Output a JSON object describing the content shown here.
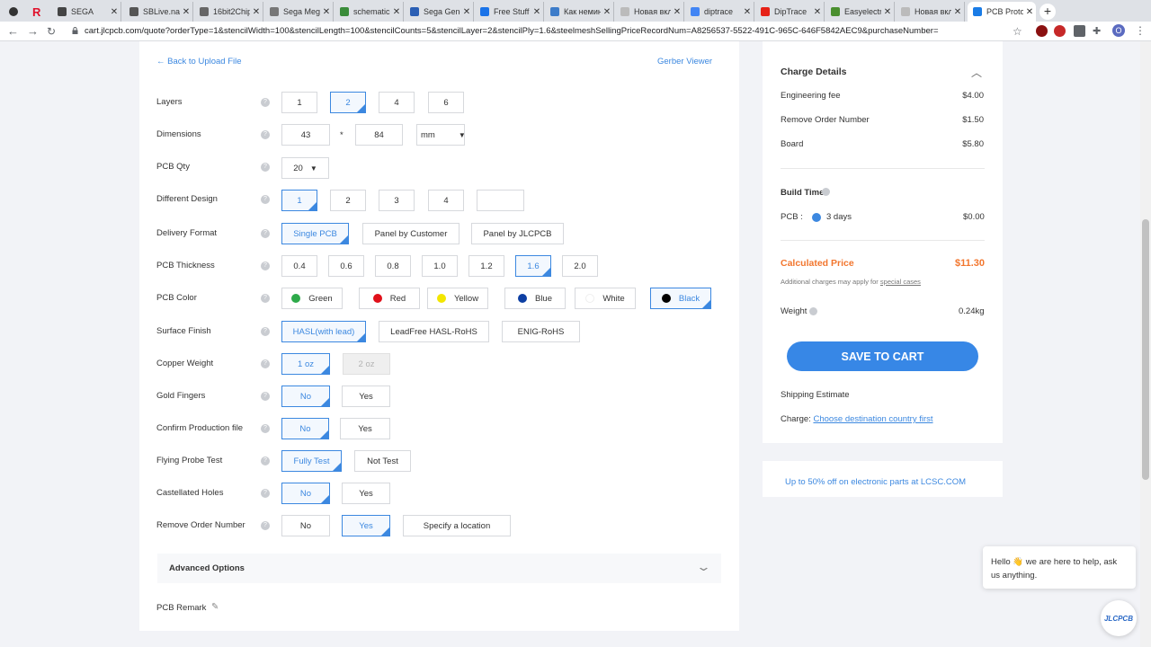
{
  "browser": {
    "tabs": [
      {
        "title": "SEGA",
        "favicon_color": "#444"
      },
      {
        "title": "SBLive.narod.ru",
        "favicon_color": "#555"
      },
      {
        "title": "16bit2Chip",
        "favicon_color": "#666"
      },
      {
        "title": "Sega Mega Drive",
        "favicon_color": "#777"
      },
      {
        "title": "schematic",
        "favicon_color": "#3a8c3a"
      },
      {
        "title": "Sega Genesis",
        "favicon_color": "#2b5fb4"
      },
      {
        "title": "Free Stuff",
        "favicon_color": "#1a73e8"
      },
      {
        "title": "Как неминуемо",
        "favicon_color": "#3d7cc9"
      },
      {
        "title": "Новая вкладка",
        "favicon_color": "#bbb"
      },
      {
        "title": "diptrace",
        "favicon_color": "#4285f4"
      },
      {
        "title": "DipTrace",
        "favicon_color": "#e62117"
      },
      {
        "title": "Easyelectronics",
        "favicon_color": "#4a8f2f"
      },
      {
        "title": "Новая вкладка",
        "favicon_color": "#bbb"
      },
      {
        "title": "PCB Prototype",
        "favicon_color": "#1a7ce6"
      }
    ],
    "url": "cart.jlcpcb.com/quote?orderType=1&stencilWidth=100&stencilLength=100&stencilCounts=5&stencilLayer=2&stencilPly=1.6&steelmeshSellingPriceRecordNum=A8256537-5522-491C-965C-646F5842AEC9&purchaseNumber=",
    "profile_initial": "O"
  },
  "nav": {
    "back": "Back to Upload File",
    "gerber": "Gerber Viewer"
  },
  "form": {
    "layers": {
      "label": "Layers",
      "options": [
        "1",
        "2",
        "4",
        "6"
      ]
    },
    "dimensions": {
      "label": "Dimensions",
      "width": "43",
      "x": "*",
      "length": "84",
      "unit": "mm"
    },
    "qty": {
      "label": "PCB Qty",
      "value": "20"
    },
    "design": {
      "label": "Different Design",
      "options": [
        "1",
        "2",
        "3",
        "4"
      ]
    },
    "delivery": {
      "label": "Delivery Format",
      "options": [
        "Single PCB",
        "Panel by Customer",
        "Panel by JLCPCB"
      ]
    },
    "thickness": {
      "label": "PCB Thickness",
      "options": [
        "0.4",
        "0.6",
        "0.8",
        "1.0",
        "1.2",
        "1.6",
        "2.0"
      ]
    },
    "color": {
      "label": "PCB Color",
      "options": [
        {
          "name": "Green",
          "hex": "#2eaa4a"
        },
        {
          "name": "Red",
          "hex": "#e0101a"
        },
        {
          "name": "Yellow",
          "hex": "#f3e600"
        },
        {
          "name": "Blue",
          "hex": "#0d3fa3"
        },
        {
          "name": "White",
          "hex": "#ffffff"
        },
        {
          "name": "Black",
          "hex": "#000000"
        }
      ]
    },
    "finish": {
      "label": "Surface Finish",
      "options": [
        "HASL(with lead)",
        "LeadFree HASL-RoHS",
        "ENIG-RoHS"
      ]
    },
    "copper": {
      "label": "Copper Weight",
      "options": [
        "1 oz",
        "2 oz"
      ]
    },
    "gold": {
      "label": "Gold Fingers",
      "options": [
        "No",
        "Yes"
      ]
    },
    "confirm": {
      "label": "Confirm Production file",
      "options": [
        "No",
        "Yes"
      ]
    },
    "probe": {
      "label": "Flying Probe Test",
      "options": [
        "Fully Test",
        "Not Test"
      ]
    },
    "castellated": {
      "label": "Castellated Holes",
      "options": [
        "No",
        "Yes"
      ]
    },
    "remove": {
      "label": "Remove Order Number",
      "options": [
        "No",
        "Yes",
        "Specify a location"
      ]
    },
    "advanced": "Advanced Options",
    "remark": "PCB Remark"
  },
  "charge": {
    "title": "Charge Details",
    "items": [
      {
        "label": "Engineering fee",
        "value": "$4.00"
      },
      {
        "label": "Remove Order Number",
        "value": "$1.50"
      },
      {
        "label": "Board",
        "value": "$5.80"
      }
    ],
    "build_time": "Build Time",
    "pcb_label": "PCB :",
    "pcb_days": "3 days",
    "pcb_price": "$0.00",
    "calc_label": "Calculated Price",
    "calc_value": "$11.30",
    "note": "Additional charges may apply for",
    "note_link": "special cases",
    "weight_label": "Weight",
    "weight_value": "0.24kg",
    "save": "SAVE TO CART",
    "shipping": "Shipping Estimate",
    "charge_label": "Charge:",
    "charge_link": "Choose destination country first"
  },
  "promo": "Up to 50% off on electronic parts at LCSC.COM",
  "chat": {
    "hello": "Hello",
    "wave": "👋",
    "rest": "we are here to help, ask us anything.",
    "logo": "JLCPCB"
  },
  "colors": {
    "accent": "#3c88e0",
    "price": "#f2762e",
    "save": "#3787e6"
  }
}
